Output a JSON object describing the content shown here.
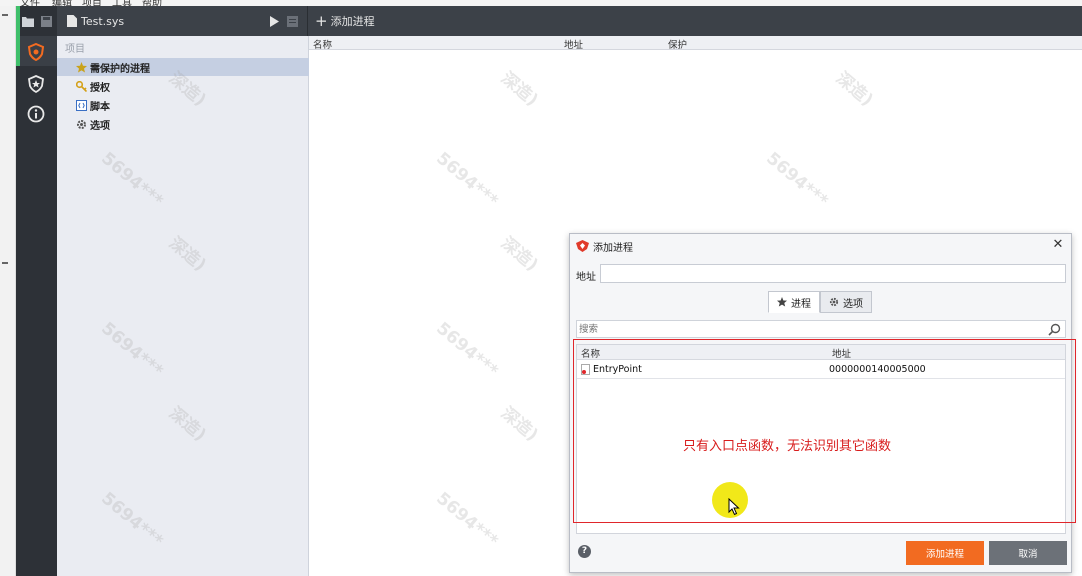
{
  "menubar": {
    "items": [
      "文件",
      "编辑",
      "项目",
      "工具",
      "帮助"
    ]
  },
  "toolbar": {
    "file_name": "Test.sys",
    "add_process_label": "添加进程"
  },
  "tree": {
    "header": "项目",
    "items": [
      {
        "label": "需保护的进程",
        "icon": "star-icon"
      },
      {
        "label": "授权",
        "icon": "key-icon"
      },
      {
        "label": "脚本",
        "icon": "script-icon"
      },
      {
        "label": "选项",
        "icon": "gear-icon"
      }
    ]
  },
  "list": {
    "columns": [
      "名称",
      "地址",
      "保护"
    ]
  },
  "watermark": {
    "line1": "5694***",
    "line2": "深造)"
  },
  "dialog": {
    "title": "添加进程",
    "address_label": "地址",
    "address_value": "",
    "tabs": [
      {
        "label": "进程",
        "icon": "star-icon"
      },
      {
        "label": "选项",
        "icon": "gear-icon"
      }
    ],
    "search_placeholder": "搜索",
    "grid": {
      "columns": [
        "名称",
        "地址"
      ],
      "rows": [
        {
          "name": "EntryPoint",
          "address": "0000000140005000"
        }
      ]
    },
    "add_button": "添加进程",
    "cancel_button": "取消"
  },
  "annotation": {
    "text": "只有入口点函数，无法识别其它函数"
  },
  "colors": {
    "accent": "#f26b21",
    "annotation": "#e0262b",
    "rail": "#2d3137",
    "toolbar": "#3c4148"
  }
}
